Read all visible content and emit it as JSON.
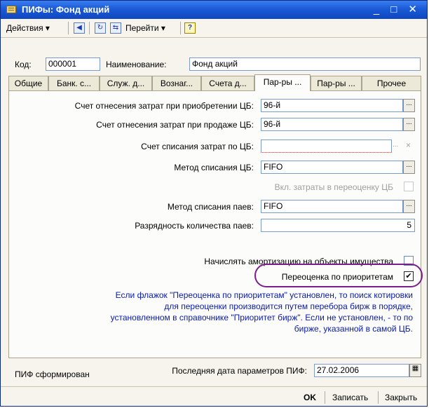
{
  "window": {
    "title": "ПИФы: Фонд акций",
    "controls": "_ □ ✕"
  },
  "toolbar": {
    "actions": "Действия",
    "goto": "Перейти",
    "help": "?"
  },
  "header": {
    "code_label": "Код:",
    "code_value": "000001",
    "name_label": "Наименование:",
    "name_value": "Фонд акций"
  },
  "tabs": [
    {
      "label": "Общие"
    },
    {
      "label": "Банк. с..."
    },
    {
      "label": "Служ. д..."
    },
    {
      "label": "Вознаг..."
    },
    {
      "label": "Счета д..."
    },
    {
      "label": "Пар-ры ..."
    },
    {
      "label": "Пар-ры ..."
    },
    {
      "label": "Прочее"
    }
  ],
  "params": {
    "acq_label": "Счет отнесения затрат при приобретении ЦБ:",
    "acq_value": "96-й",
    "sale_label": "Счет отнесения затрат при продаже ЦБ:",
    "sale_value": "96-й",
    "writeoff_label": "Счет списания затрат по ЦБ:",
    "writeoff_value": "",
    "method_label": "Метод списания ЦБ:",
    "method_value": "FIFO",
    "revalue_label": "Вкл. затраты в переоценку ЦБ",
    "share_method_label": "Метод списания паев:",
    "share_method_value": "FIFO",
    "digits_label": "Разрядность количества паев:",
    "digits_value": "5",
    "amort_label": "Начислять амортизацию на объекты имущества",
    "priority_label": "Переоценка по приоритетам",
    "info_text": "Если флажок \"Переоценка по приоритетам\" установлен, то поиск котировки для переоценки производится путем перебора бирж в порядке, установленном в справочнике \"Приоритет бирж\". Если не установлен, - то по бирже, указанной в самой ЦБ."
  },
  "footer": {
    "formed_label": "ПИФ сформирован",
    "lastdate_label": "Последняя дата параметров ПИФ:",
    "lastdate_value": "27.02.2006"
  },
  "buttons": {
    "ok": "OK",
    "save": "Записать",
    "close": "Закрыть"
  },
  "ellipsis": "...",
  "clear_x": "×",
  "priority_checked": true,
  "colors": {
    "title_bar": "#1a5bd6",
    "info_text": "#0a1aa8",
    "highlight_oval": "#7a1e8a"
  }
}
